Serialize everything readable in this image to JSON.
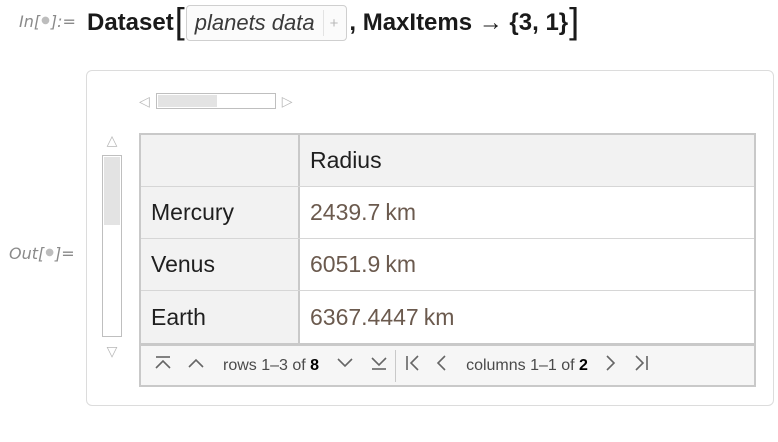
{
  "input": {
    "label_prefix": "In[",
    "label_suffix": "]:=",
    "function_name": "Dataset",
    "entity_text": "planets data",
    "entity_plus": "+",
    "option_text": ", MaxItems → {3, 1}",
    "open_bracket": "[",
    "close_bracket": "]"
  },
  "output": {
    "label_prefix": "Out[",
    "label_suffix": "]="
  },
  "table": {
    "header": "Radius",
    "rows": [
      {
        "name": "Mercury",
        "value": "2439.7",
        "unit": "km"
      },
      {
        "name": "Venus",
        "value": "6051.9",
        "unit": "km"
      },
      {
        "name": "Earth",
        "value": "6367.4447",
        "unit": "km"
      }
    ]
  },
  "footer": {
    "rows_text": "rows 1–3 of",
    "rows_total": "8",
    "cols_text": "columns 1–1 of",
    "cols_total": "2"
  },
  "icons": {
    "first_row": "first-row-icon",
    "prev_row": "prev-row-icon",
    "next_row": "next-row-icon",
    "last_row": "last-row-icon",
    "first_col": "first-column-icon",
    "prev_col": "prev-column-icon",
    "next_col": "next-column-icon",
    "last_col": "last-column-icon"
  }
}
